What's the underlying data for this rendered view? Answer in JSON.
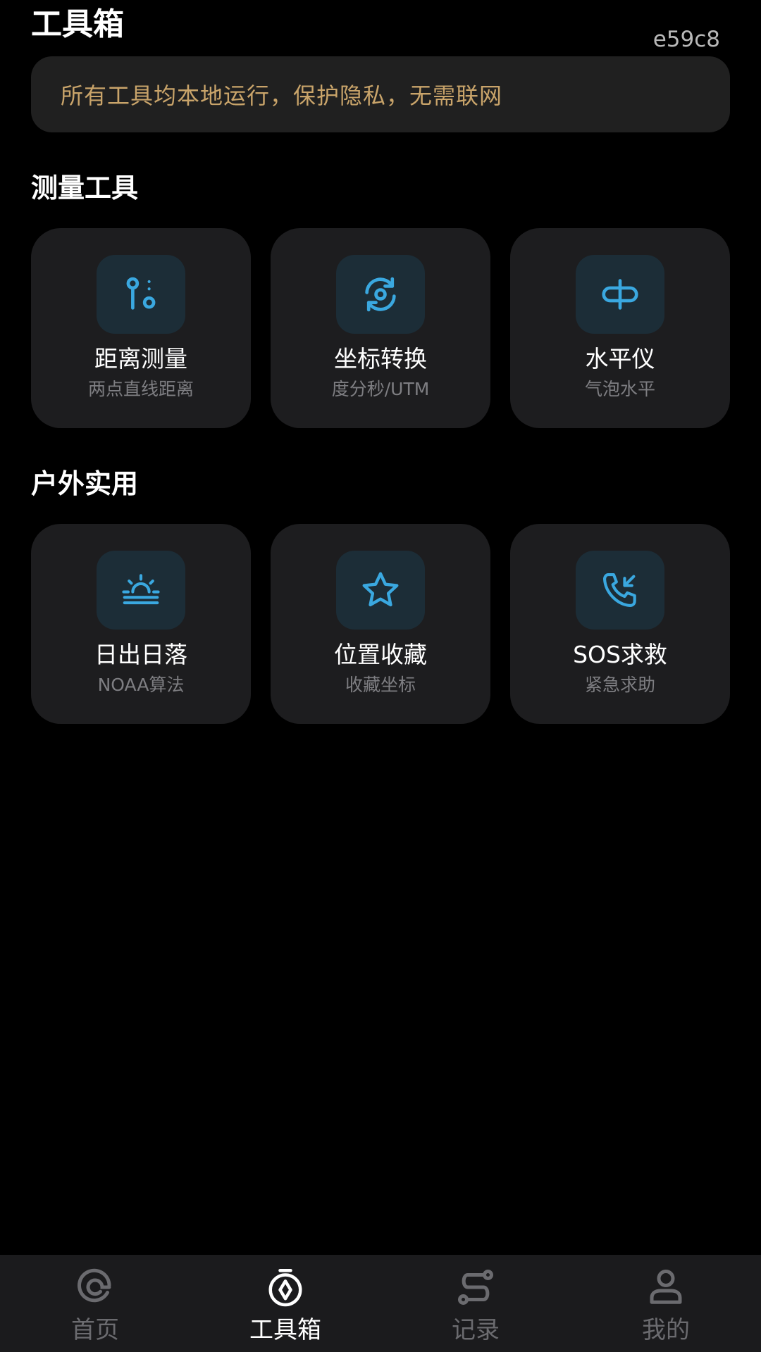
{
  "header": {
    "title": "工具箱",
    "tag": "e59c8"
  },
  "notice": {
    "text": "所有工具均本地运行，保护隐私，无需联网"
  },
  "sections": [
    {
      "title": "测量工具",
      "tools": [
        {
          "name": "距离测量",
          "desc": "两点直线距离",
          "icon": "distance-icon"
        },
        {
          "name": "坐标转换",
          "desc": "度分秒/UTM",
          "icon": "convert-icon"
        },
        {
          "name": "水平仪",
          "desc": "气泡水平",
          "icon": "level-icon"
        }
      ]
    },
    {
      "title": "户外实用",
      "tools": [
        {
          "name": "日出日落",
          "desc": "NOAA算法",
          "icon": "sunrise-icon"
        },
        {
          "name": "位置收藏",
          "desc": "收藏坐标",
          "icon": "star-icon"
        },
        {
          "name": "SOS求救",
          "desc": "紧急求助",
          "icon": "phone-call-icon"
        }
      ]
    }
  ],
  "tabbar": {
    "items": [
      {
        "label": "首页",
        "icon": "home-icon",
        "active": false
      },
      {
        "label": "工具箱",
        "icon": "compass-icon",
        "active": true
      },
      {
        "label": "记录",
        "icon": "route-icon",
        "active": false
      },
      {
        "label": "我的",
        "icon": "user-icon",
        "active": false
      }
    ]
  },
  "colors": {
    "background": "#000000",
    "card": "#1d1d1f",
    "icon_box": "#1c2d37",
    "accent_blue": "#3aa8e0",
    "notice_text": "#c9a46a",
    "tab_inactive": "#6b6b6f"
  }
}
